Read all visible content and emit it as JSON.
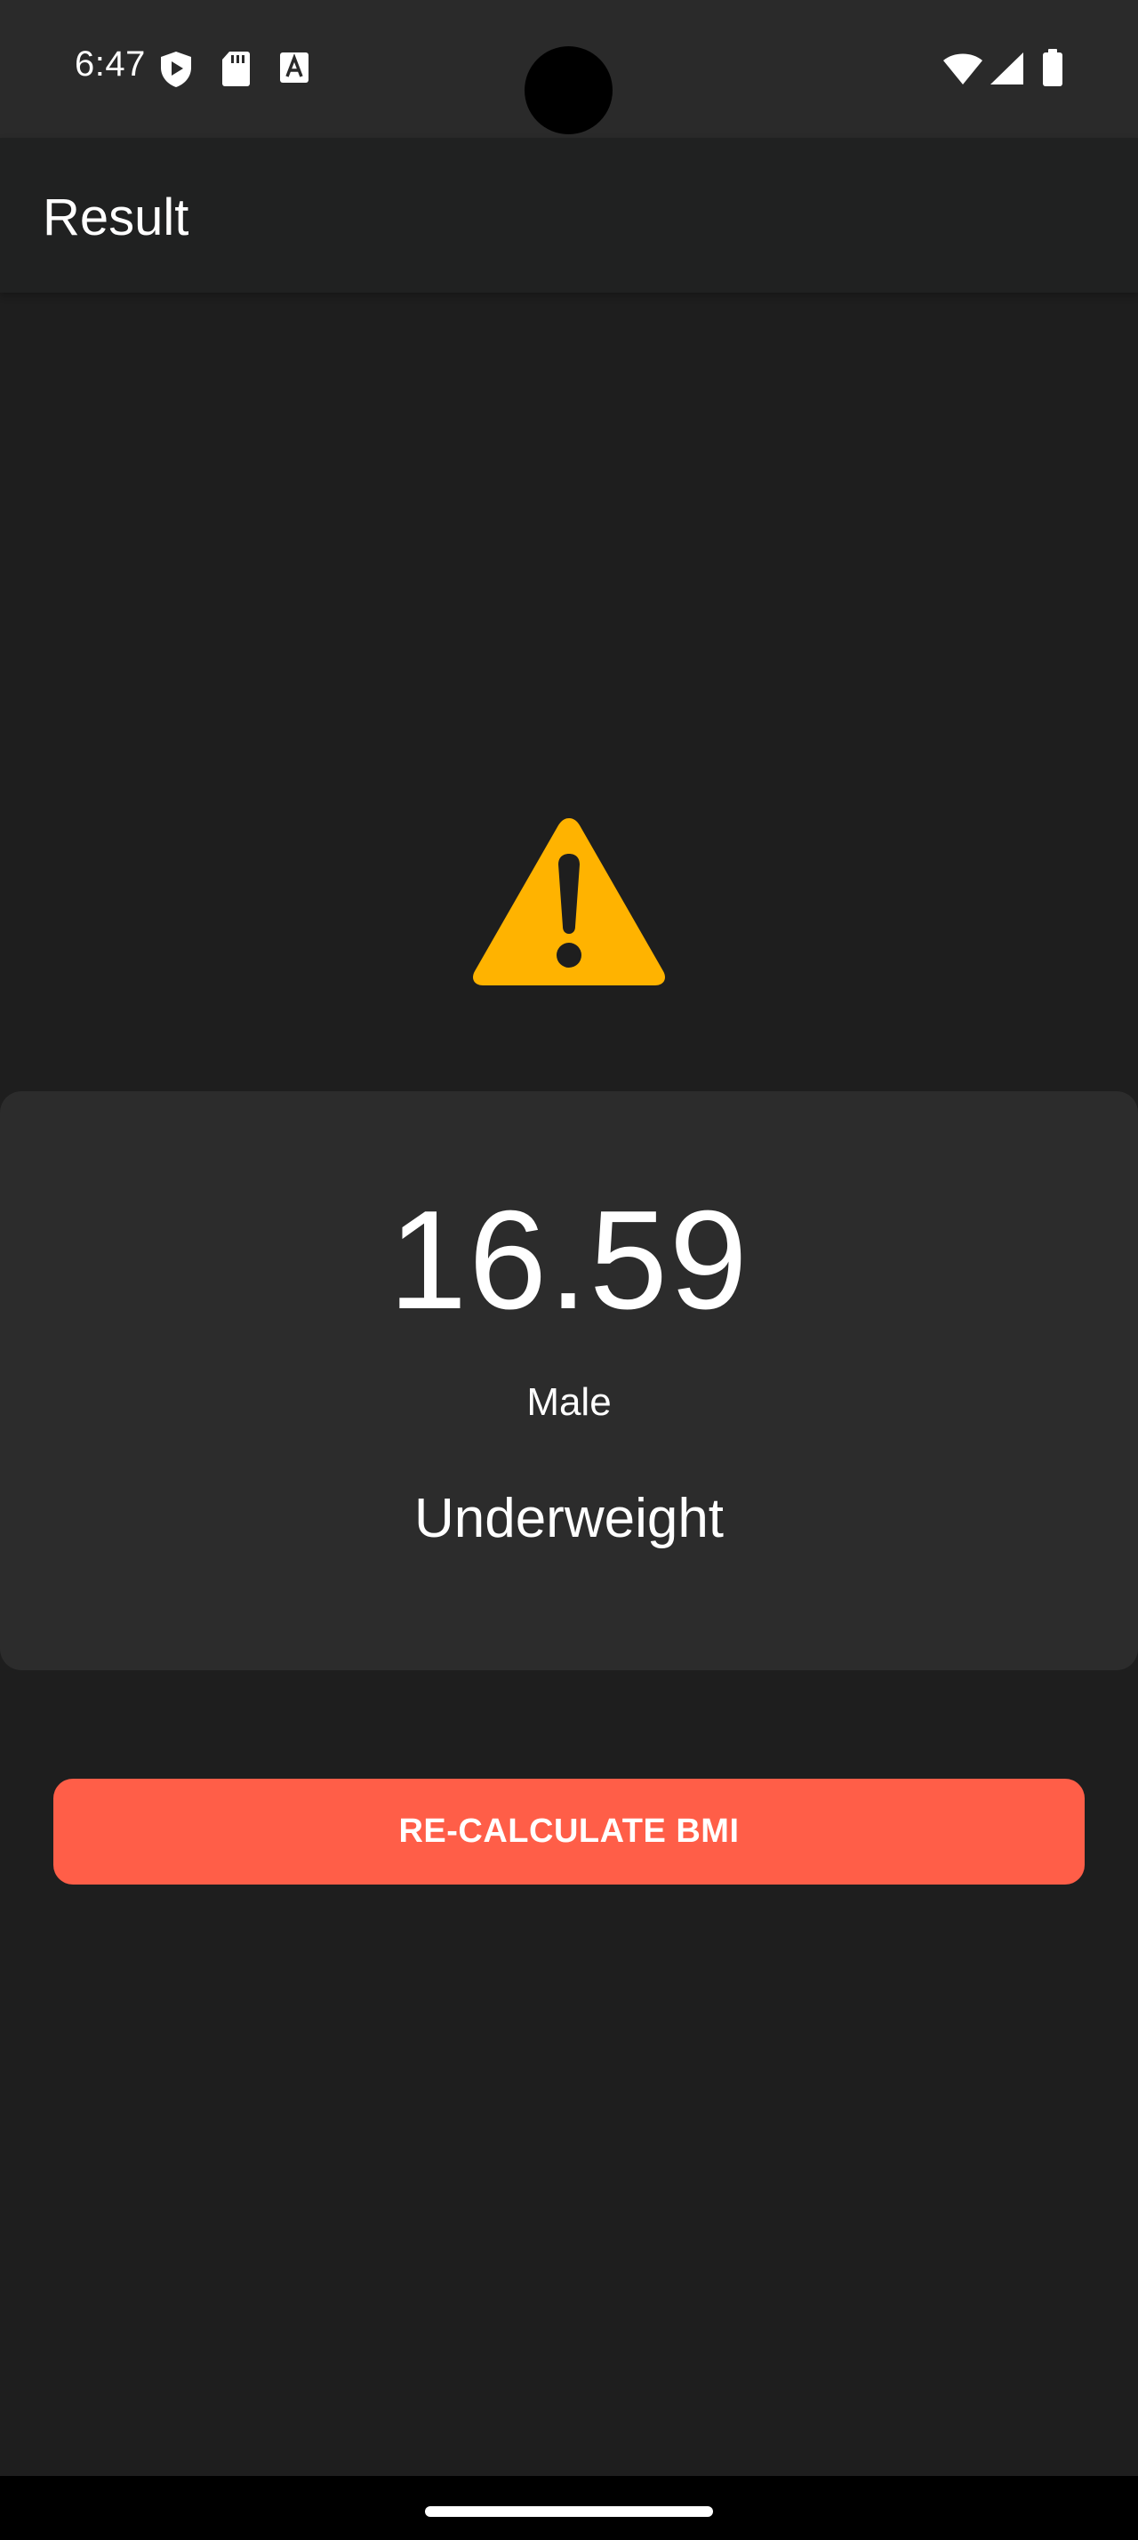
{
  "status_bar": {
    "time": "6:47",
    "icons": [
      "shield-play-icon",
      "sd-card-icon",
      "text-a-icon",
      "wifi-icon",
      "cell-signal-icon",
      "battery-icon"
    ]
  },
  "app_bar": {
    "title": "Result"
  },
  "result": {
    "icon": "warning-icon",
    "icon_color": "#FFB300",
    "bmi": "16.59",
    "gender": "Male",
    "category": "Underweight"
  },
  "actions": {
    "recalculate_label": "RE-CALCULATE BMI",
    "button_color": "#FF5E48"
  }
}
